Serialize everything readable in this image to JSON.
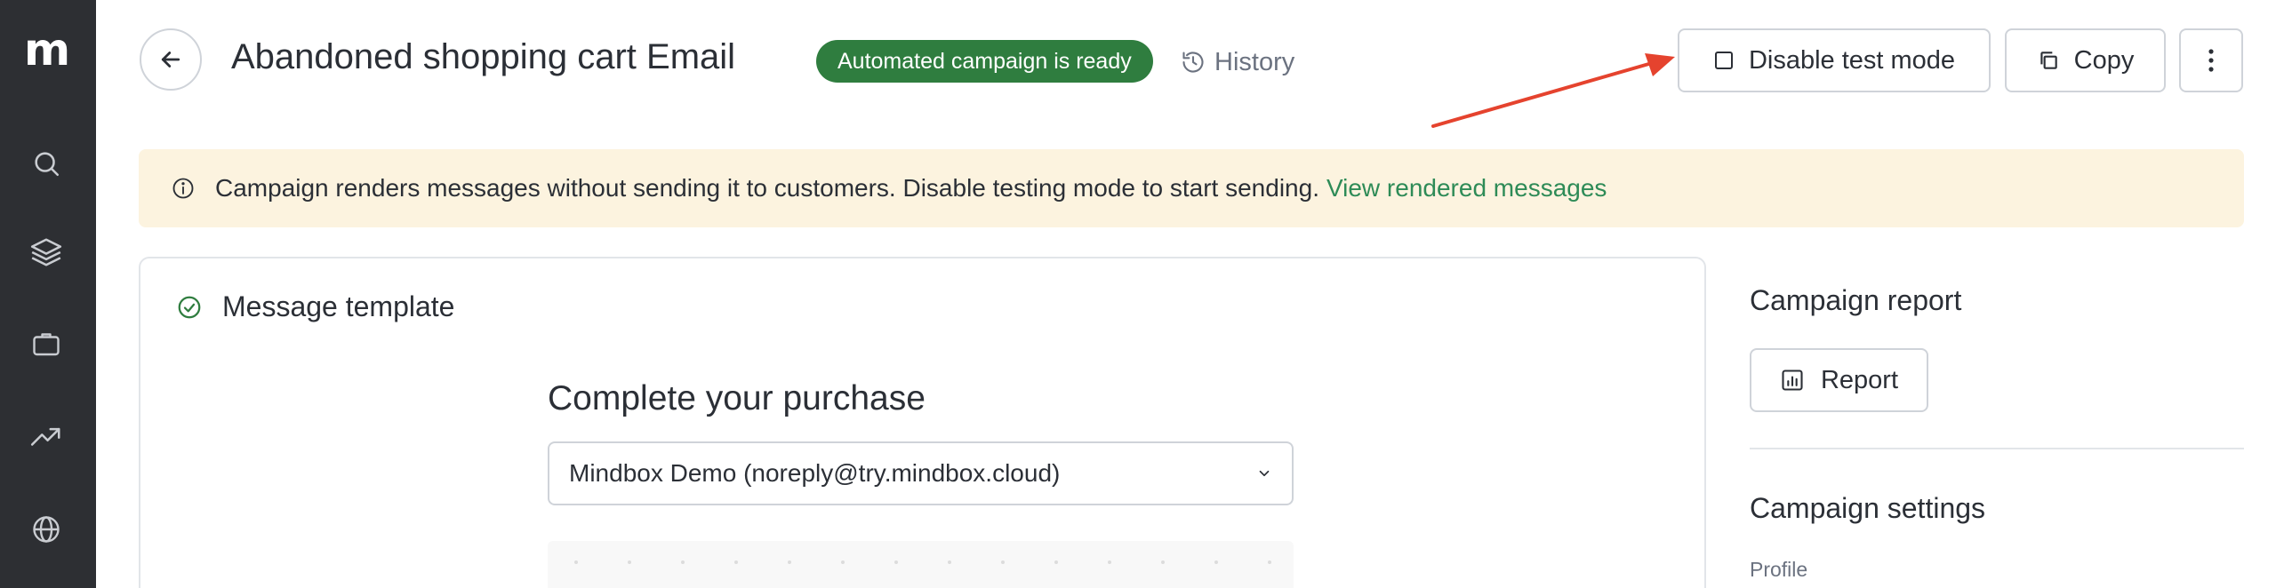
{
  "sidebar": {
    "logo": "m",
    "nav": [
      "search-icon",
      "layers-icon",
      "briefcase-icon",
      "trending-up-icon",
      "globe-icon"
    ]
  },
  "header": {
    "title": "Abandoned shopping cart Email",
    "status_badge": "Automated campaign is ready",
    "history_label": "History",
    "disable_test_label": "Disable test mode",
    "copy_label": "Copy"
  },
  "banner": {
    "message": "Campaign renders messages without sending it to customers. Disable testing mode to start sending.",
    "link_label": "View rendered messages"
  },
  "message_template": {
    "title": "Message template",
    "subject": "Complete your purchase",
    "sender": "Mindbox Demo (noreply@try.mindbox.cloud)"
  },
  "right_panel": {
    "report_title": "Campaign report",
    "report_button": "Report",
    "settings_title": "Campaign settings",
    "profile_label": "Profile"
  },
  "colors": {
    "sidebar_bg": "#2d2f33",
    "badge_green": "#2f7d3f",
    "banner_bg": "#fcf3df",
    "link_green": "#2e8b57",
    "annotation_arrow": "#e5432e"
  }
}
